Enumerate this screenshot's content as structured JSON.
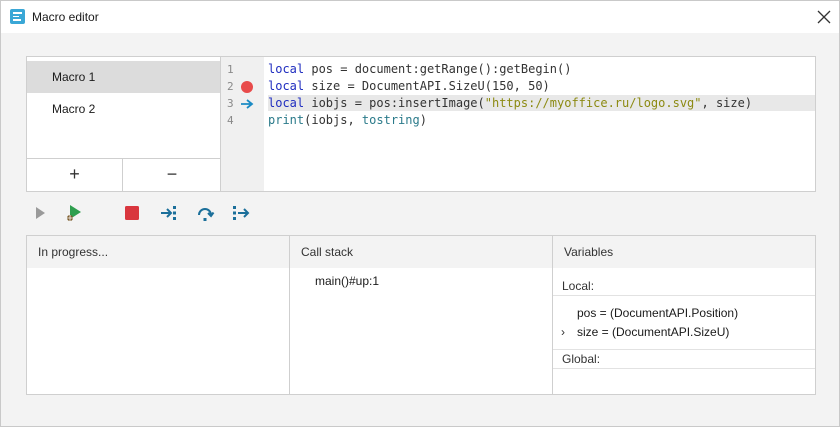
{
  "window": {
    "title": "Macro editor"
  },
  "macros": {
    "items": [
      "Macro 1",
      "Macro 2"
    ],
    "add_label": "+",
    "remove_label": "−"
  },
  "editor": {
    "line_numbers": [
      "1",
      "2",
      "3",
      "4"
    ],
    "lines": [
      [
        [
          "kw",
          "local"
        ],
        [
          "plain",
          " pos = document:getRange():getBegin()"
        ]
      ],
      [
        [
          "kw",
          "local"
        ],
        [
          "plain",
          " size = DocumentAPI.SizeU(150, 50)"
        ]
      ],
      [
        [
          "kw",
          "local"
        ],
        [
          "plain",
          " iobjs = pos:insertImage("
        ],
        [
          "str",
          "\"https://myoffice.ru/logo.svg\""
        ],
        [
          "plain",
          ", size)"
        ]
      ],
      [
        [
          "fn",
          "print"
        ],
        [
          "plain",
          "(iobjs, "
        ],
        [
          "fn",
          "tostring"
        ],
        [
          "plain",
          ")"
        ]
      ]
    ],
    "breakpoint_line": "2",
    "current_line": "3"
  },
  "toolbar": {
    "icons": [
      "run-icon",
      "debug-icon",
      "stop-icon",
      "step-into-icon",
      "step-over-icon",
      "step-out-icon"
    ]
  },
  "panels": {
    "progress_header": "In progress...",
    "stack_header": "Call stack",
    "stack_items": [
      "main()#up:1"
    ],
    "vars_header": "Variables",
    "local_label": "Local:",
    "local_vars": [
      "pos = (DocumentAPI.Position)",
      "size = (DocumentAPI.SizeU)"
    ],
    "global_label": "Global:"
  },
  "colors": {
    "breakpoint": "#e84b4b",
    "arrow": "#1b8bc4",
    "stop": "#d9363e",
    "run": "#2e9e4e"
  }
}
